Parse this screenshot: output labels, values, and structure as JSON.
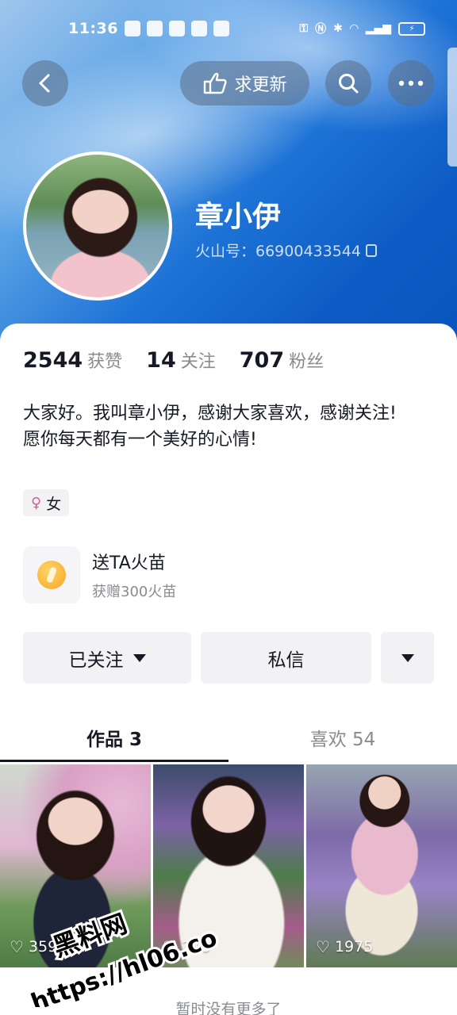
{
  "status_bar": {
    "time": "11:36",
    "battery": ""
  },
  "nav": {
    "update_label": "求更新"
  },
  "profile": {
    "name": "章小伊",
    "id_label": "火山号：66900433544"
  },
  "stats": [
    {
      "value": "2544",
      "label": "获赞"
    },
    {
      "value": "14",
      "label": "关注"
    },
    {
      "value": "707",
      "label": "粉丝"
    }
  ],
  "bio": {
    "line1": "大家好。我叫章小伊，感谢大家喜欢，感谢关注!",
    "line2": "愿你每天都有一个美好的心情!"
  },
  "gender_tag": {
    "icon": "♀",
    "label": "女"
  },
  "gift": {
    "title": "送TA火苗",
    "subtitle": "获赠300火苗"
  },
  "actions": {
    "followed": "已关注",
    "message": "私信"
  },
  "tabs": [
    {
      "label": "作品 3"
    },
    {
      "label": "喜欢 54"
    }
  ],
  "works": [
    {
      "likes": "359"
    },
    {
      "likes": "210"
    },
    {
      "likes": "1975"
    }
  ],
  "footer": {
    "no_more": "暂时没有更多了"
  },
  "watermark": {
    "line1": "黑料网",
    "line2": "https://hl06.co"
  }
}
